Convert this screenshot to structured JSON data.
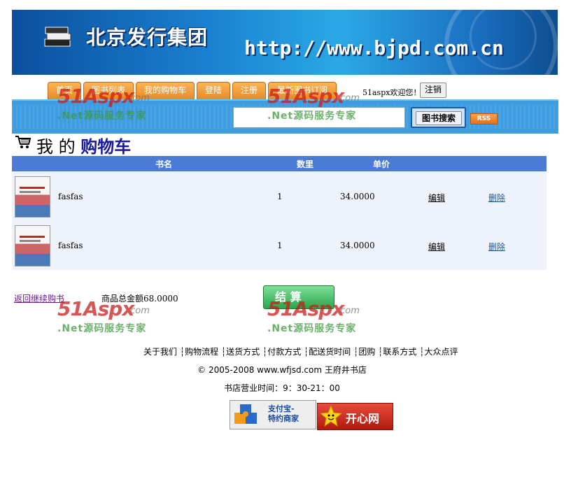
{
  "banner": {
    "title": "北京发行集团",
    "url": "http://www.bjpd.com.cn"
  },
  "nav": {
    "tabs": [
      {
        "label": "首页"
      },
      {
        "label": "图书列表"
      },
      {
        "label": "我的购物车"
      },
      {
        "label": "登陆"
      },
      {
        "label": "注册"
      },
      {
        "label": "最新图书订阅"
      }
    ],
    "welcome": "51aspx欢迎您！",
    "logout_label": "注销"
  },
  "search": {
    "button_label": "图书搜索",
    "rss_label": "RSS"
  },
  "watermark": {
    "logo": "51Aspx",
    "domain": ".com",
    "slogan": ".Net源码服务专家"
  },
  "cart": {
    "title_prefix": "我 的",
    "title_bold": "购物车",
    "columns": [
      "书名",
      "数里",
      "单价"
    ],
    "rows": [
      {
        "name": "fasfas",
        "qty": "1",
        "price": "34.0000",
        "edit": "编辑",
        "delete": "删除"
      },
      {
        "name": "fasfas",
        "qty": "1",
        "price": "34.0000",
        "edit": "编辑",
        "delete": "删除"
      }
    ],
    "back_link": "返回继续购书",
    "total": "商品总金额68.0000",
    "checkout_label": "结 算"
  },
  "footer": {
    "links": [
      "关于我们",
      "购物流程",
      "送货方式",
      "付款方式",
      "配送货时间",
      "团购",
      "联系方式",
      "大众点评"
    ],
    "copyright": "© 2005-2008 www.wfjsd.com 王府井书店",
    "hours": "书店营业时间：9：30-21：00",
    "alipay_line1": "支付宝-",
    "alipay_line2": "特约商家",
    "kaixin_label": "开心网"
  },
  "colors": {
    "nav_tab": "#e78a22",
    "search_bar": "#3e9de0",
    "table_header": "#4b7bd5",
    "checkout": "#2aa64a"
  }
}
